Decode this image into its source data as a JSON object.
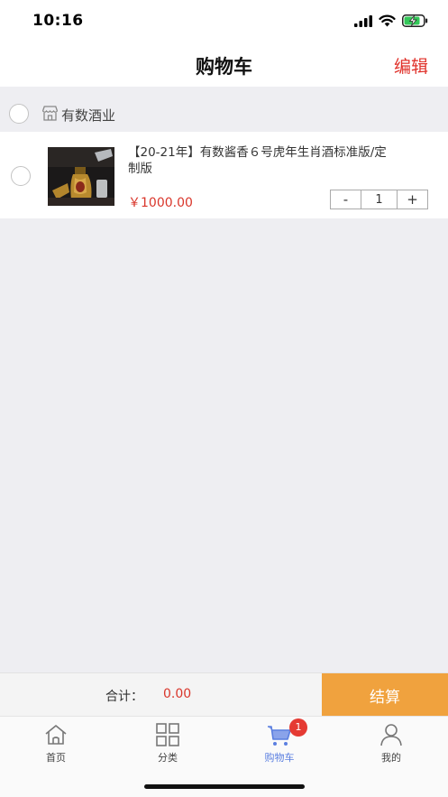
{
  "status_bar": {
    "time": "10:16"
  },
  "nav": {
    "title": "购物车",
    "edit_label": "编辑"
  },
  "shop": {
    "name": "有数酒业",
    "icon": "store-icon"
  },
  "cart_items": [
    {
      "title": "【20-21年】有数酱香６号虎年生肖酒标准版/定制版",
      "price": "￥1000.00",
      "quantity": "1",
      "decrement_label": "-",
      "increment_label": "+"
    }
  ],
  "checkout": {
    "total_label": "合计：",
    "total_value": "0.00",
    "button_label": "结算",
    "button_color": "#f0a23e"
  },
  "tabs": [
    {
      "label": "首页",
      "icon": "home-icon"
    },
    {
      "label": "分类",
      "icon": "category-icon"
    },
    {
      "label": "购物车",
      "icon": "cart-icon",
      "badge": "1",
      "active": true
    },
    {
      "label": "我的",
      "icon": "user-icon"
    }
  ],
  "colors": {
    "accent_red": "#e0312a",
    "price_red": "#d9362b",
    "active_tab": "#5b7fe0"
  }
}
